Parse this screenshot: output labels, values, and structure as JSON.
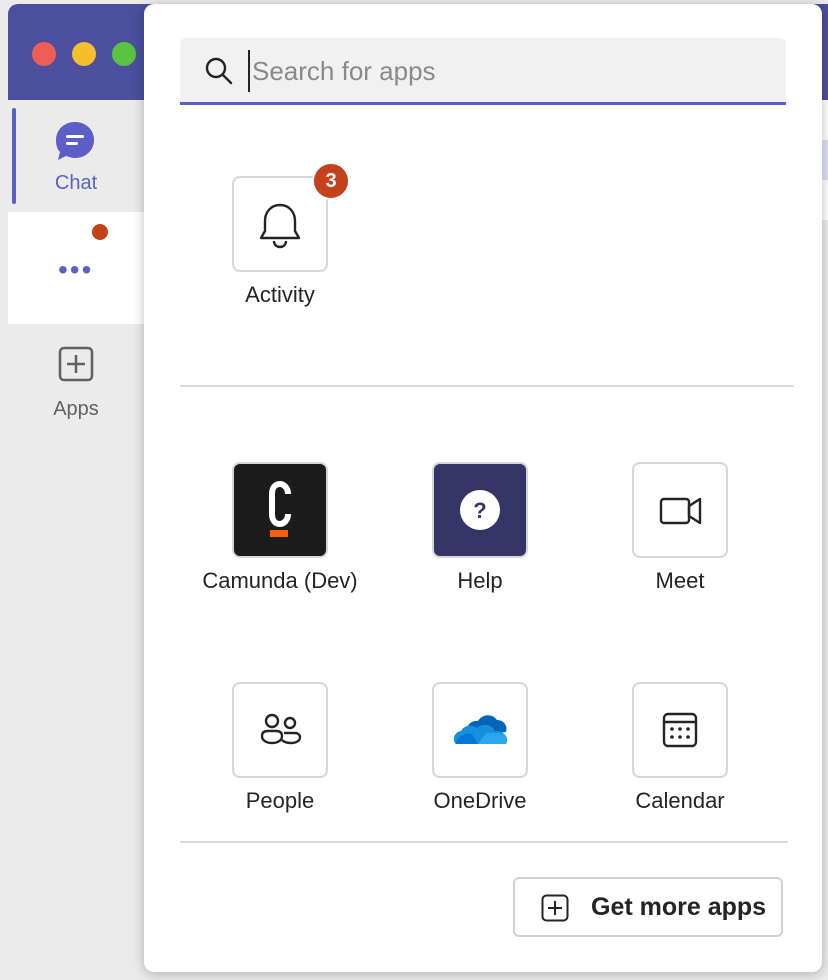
{
  "colors": {
    "accent": "#5b5fc7",
    "badge": "#c4411b",
    "titlebar": "#4b4f9e"
  },
  "rail": {
    "chat_label": "Chat",
    "more_icon": "more-horizontal-icon",
    "apps_label": "Apps"
  },
  "search": {
    "placeholder": "Search for apps",
    "value": ""
  },
  "pinned": [
    {
      "name": "Activity",
      "icon": "bell-icon",
      "badge": "3"
    }
  ],
  "apps": [
    {
      "name": "Camunda (Dev)",
      "icon": "camunda-logo"
    },
    {
      "name": "Help",
      "icon": "help-question-icon"
    },
    {
      "name": "Meet",
      "icon": "video-camera-icon"
    },
    {
      "name": "People",
      "icon": "people-icon"
    },
    {
      "name": "OneDrive",
      "icon": "onedrive-cloud-icon"
    },
    {
      "name": "Calendar",
      "icon": "calendar-icon"
    }
  ],
  "footer": {
    "get_more_label": "Get more apps"
  }
}
